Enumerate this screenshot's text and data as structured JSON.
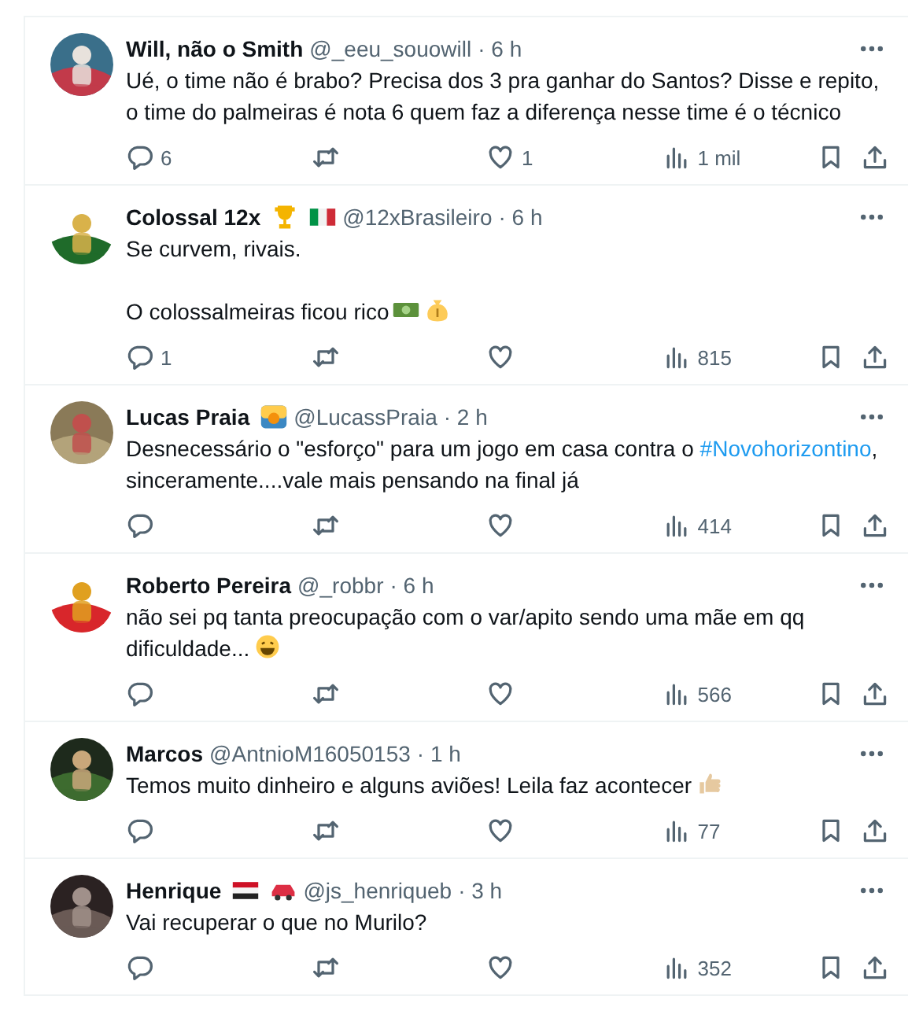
{
  "tweets": [
    {
      "avatar": {
        "kind": "picture"
      },
      "name": "Will, não o Smith",
      "handle": "@_eeu_souowill",
      "time": "· 6 h",
      "paragraphs": [
        {
          "parts": [
            {
              "kind": "text",
              "text": "Ué, o time não é brabo? Precisa dos 3 pra ganhar do Santos? Disse e repito, o time do palmeiras é nota 6 quem faz a diferença nesse time é o técnico"
            }
          ]
        }
      ],
      "replies": "6",
      "likes": "1",
      "views": "1 mil"
    },
    {
      "avatar": {
        "kind": "picture"
      },
      "name": "Colossal 12x",
      "badges": [
        {
          "kind": "trophy"
        },
        {
          "kind": "flag-italy"
        }
      ],
      "handle": "@12xBrasileiro",
      "time": "· 6 h",
      "paragraphs": [
        {
          "parts": [
            {
              "kind": "text",
              "text": "Se curvem, rivais."
            }
          ]
        },
        {
          "parts": [
            {
              "kind": "text",
              "text": "O colossalmeiras ficou rico"
            }
          ],
          "emojis": [
            {
              "kind": "money"
            },
            {
              "kind": "moneybag"
            }
          ]
        }
      ],
      "replies": "1",
      "views": "815"
    },
    {
      "avatar": {
        "kind": "picture"
      },
      "name": "Lucas Praia",
      "badges": [
        {
          "kind": "sunset"
        }
      ],
      "handle": "@LucassPraia",
      "time": "· 2 h",
      "paragraphs": [
        {
          "parts": [
            {
              "kind": "text",
              "text": "Desnecessário o \"esforço\" para um jogo em casa contra o "
            },
            {
              "kind": "hashtag",
              "text": "#Novohorizontino"
            },
            {
              "kind": "text",
              "text": ", sinceramente....vale mais pensando na final já"
            }
          ]
        }
      ],
      "views": "414"
    },
    {
      "avatar": {
        "kind": "picture"
      },
      "name": "Roberto Pereira",
      "handle": "@_robbr",
      "time": "· 6 h",
      "paragraphs": [
        {
          "parts": [
            {
              "kind": "text",
              "text": "não sei pq tanta preocupação com o var/apito sendo uma mãe em qq dificuldade..."
            }
          ],
          "emojis": [
            {
              "kind": "grin"
            }
          ]
        }
      ],
      "views": "566"
    },
    {
      "avatar": {
        "kind": "picture"
      },
      "name": "Marcos",
      "handle": "@AntnioM16050153",
      "time": "· 1 h",
      "paragraphs": [
        {
          "parts": [
            {
              "kind": "text",
              "text": "Temos muito dinheiro e alguns aviões! Leila faz acontecer"
            }
          ],
          "emojis": [
            {
              "kind": "thumbs-up"
            }
          ]
        }
      ],
      "views": "77"
    },
    {
      "avatar": {
        "kind": "picture"
      },
      "name": "Henrique",
      "badges": [
        {
          "kind": "flag-egypt"
        },
        {
          "kind": "car"
        }
      ],
      "handle": "@js_henriqueb",
      "time": "· 3 h",
      "paragraphs": [
        {
          "parts": [
            {
              "kind": "text",
              "text": "Vai recuperar o que no Murilo?"
            }
          ]
        }
      ],
      "views": "352"
    }
  ]
}
